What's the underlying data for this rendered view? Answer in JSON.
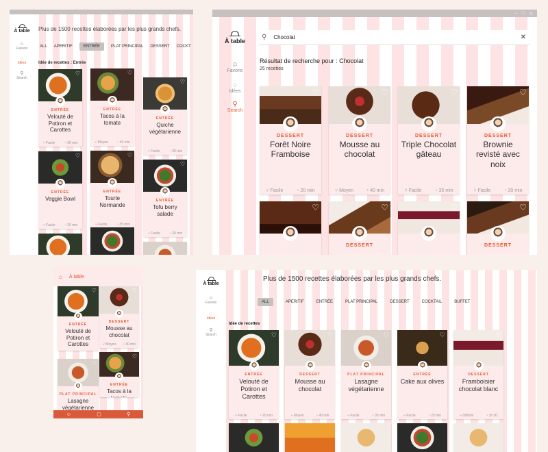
{
  "app": {
    "name": "À table"
  },
  "nav": {
    "favoris": "Favoris",
    "idees": "Idées",
    "search": "Search"
  },
  "headline": "Plus de 1500 recettes élaborées par les plus grands chefs.",
  "tabs": [
    "ALL",
    "APERITIF",
    "ENTRÉE",
    "PLAT PRINCIPAL",
    "DESSERT",
    "COCKTAIL",
    "BUFFET"
  ],
  "window_a": {
    "tabs_visible": [
      "ALL",
      "APERITIF",
      "ENTRÉE",
      "PLAT PRINCIPAL",
      "DESSERT",
      "COCKT"
    ],
    "section": "Idée de recettes : Entrée",
    "cards": [
      {
        "cat": "ENTRÉE",
        "title": "Velouté de Potiron et Carottes",
        "level": "Facile",
        "time": "20 min",
        "img": "soup"
      },
      {
        "cat": "ENTRÉE",
        "title": "Tacos à la tomate",
        "level": "Moyen",
        "time": "40 min",
        "img": "tacos"
      },
      {
        "cat": "ENTRÉE",
        "title": "Quiche végétarienne",
        "level": "Facile",
        "time": "35 min",
        "img": "quiche"
      },
      {
        "cat": "ENTRÉE",
        "title": "Veggie Bowl",
        "level": "Facile",
        "time": "20 min",
        "img": "bowl"
      },
      {
        "cat": "ENTRÉE",
        "title": "Tourte Normande",
        "level": "Facile",
        "time": "35 min",
        "img": "tourte"
      },
      {
        "cat": "ENTRÉE",
        "title": "Tofu berry salade",
        "level": "Facile",
        "time": "20 min",
        "img": "salad"
      }
    ]
  },
  "window_b": {
    "search_value": "Chocolat",
    "result_title": "Résultat de recherche pour : Chocolat",
    "count": "25 recettes",
    "cards": [
      {
        "cat": "DESSERT",
        "title": "Forêt Noire Framboise",
        "level": "Facile",
        "time": "20 min",
        "img": "choc1"
      },
      {
        "cat": "DESSERT",
        "title": "Mousse au chocolat",
        "level": "Moyen",
        "time": "40 min",
        "img": "choc2"
      },
      {
        "cat": "DESSERT",
        "title": "Triple Chocolat gâteau",
        "level": "Facile",
        "time": "35 min",
        "img": "choc3"
      },
      {
        "cat": "DESSERT",
        "title": "Brownie revisté avec noix",
        "level": "Facile",
        "time": "20 min",
        "img": "choc4"
      },
      {
        "cat": "",
        "title": "",
        "level": "",
        "time": "",
        "img": "choc5"
      },
      {
        "cat": "DESSERT",
        "title": "",
        "level": "",
        "time": "",
        "img": "choc6"
      },
      {
        "cat": "",
        "title": "",
        "level": "",
        "time": "",
        "img": "choc7"
      },
      {
        "cat": "DESSERT",
        "title": "",
        "level": "",
        "time": "",
        "img": "choc8"
      }
    ]
  },
  "window_c": {
    "cards": [
      {
        "cat": "ENTRÉE",
        "title": "Velouté de Potiron et Carottes",
        "img": "soup"
      },
      {
        "cat": "DESSERT",
        "title": "Mousse au chocolat",
        "level": "Moyen",
        "time": "40 min",
        "img": "choc2"
      },
      {
        "cat": "PLAT PRINCIPAL",
        "title": "Lasagne végétarienne",
        "img": "lasagne"
      },
      {
        "cat": "ENTRÉE",
        "title": "Tacos à la tomate",
        "img": "tacos"
      }
    ]
  },
  "window_d": {
    "section": "Idée de recettes",
    "cards": [
      {
        "cat": "ENTRÉE",
        "title": "Velouté de Potiron et Carottes",
        "level": "Facile",
        "time": "20 min",
        "img": "soup"
      },
      {
        "cat": "DESSERT",
        "title": "Mousse au chocolat",
        "level": "Moyen",
        "time": "40 min",
        "img": "choc2"
      },
      {
        "cat": "PLAT PRINCIPAL",
        "title": "Lasagne végétarienne",
        "level": "Facile",
        "time": "35 min",
        "img": "lasagne"
      },
      {
        "cat": "ENTRÉE",
        "title": "Cake aux olives",
        "level": "Facile",
        "time": "20 min",
        "img": "cake"
      },
      {
        "cat": "DESSERT",
        "title": "Framboisier chocolat blanc",
        "level": "Difficile",
        "time": "1h 30",
        "img": "choc7"
      }
    ]
  },
  "colors": {
    "accent": "#e8542a",
    "stripe": "#fde3e3",
    "bg": "#f9f0ec"
  }
}
